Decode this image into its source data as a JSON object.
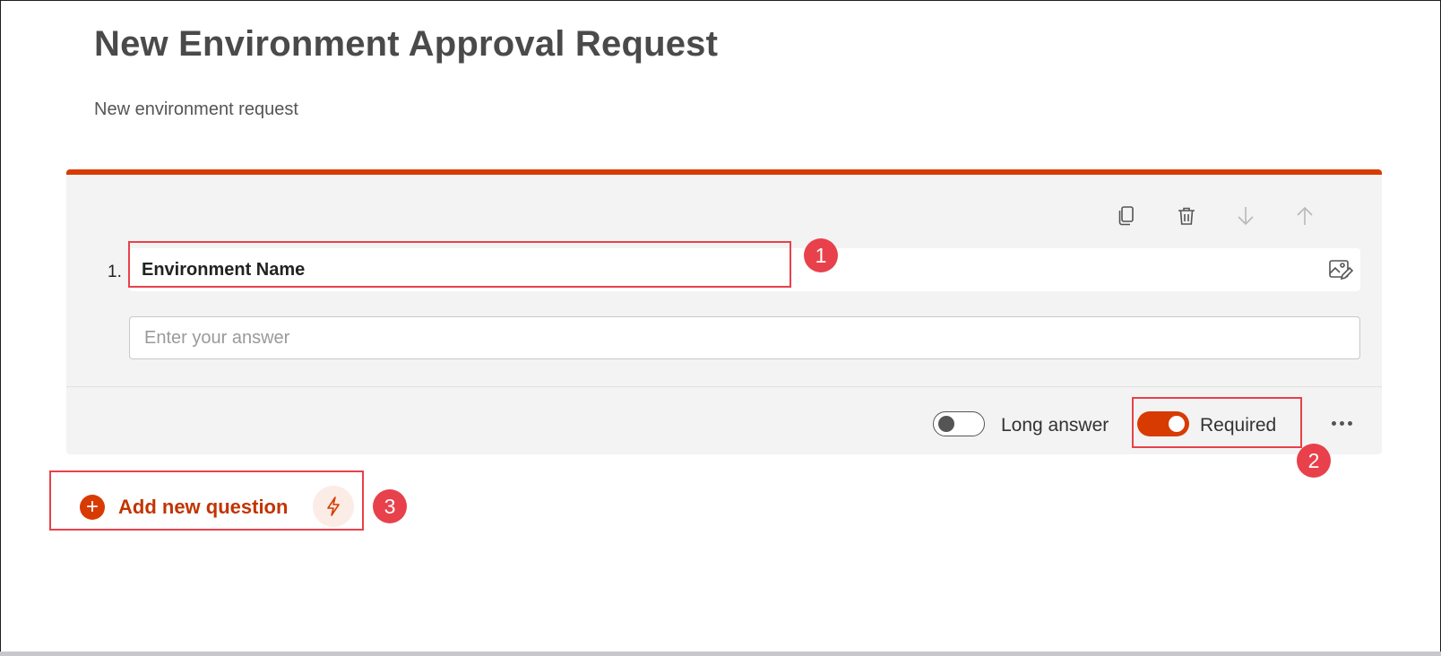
{
  "form": {
    "title": "New Environment Approval Request",
    "subtitle": "New environment request"
  },
  "question": {
    "number": "1.",
    "title": "Environment Name",
    "answer_placeholder": "Enter your answer",
    "toolbar_icons": [
      "copy-icon",
      "delete-icon",
      "move-down-icon",
      "move-up-icon"
    ],
    "image_icon": "insert-media-icon",
    "long_answer": {
      "label": "Long answer",
      "on": false
    },
    "required": {
      "label": "Required",
      "on": true
    },
    "more_icon": "more-options-icon"
  },
  "add_question": {
    "label": "Add new question",
    "plus_icon": "+",
    "bolt_icon": "lightning-icon"
  },
  "callouts": [
    "1",
    "2",
    "3"
  ],
  "colors": {
    "accent": "#d83b01",
    "highlight": "#e8414b",
    "card_background": "#f3f3f3"
  }
}
